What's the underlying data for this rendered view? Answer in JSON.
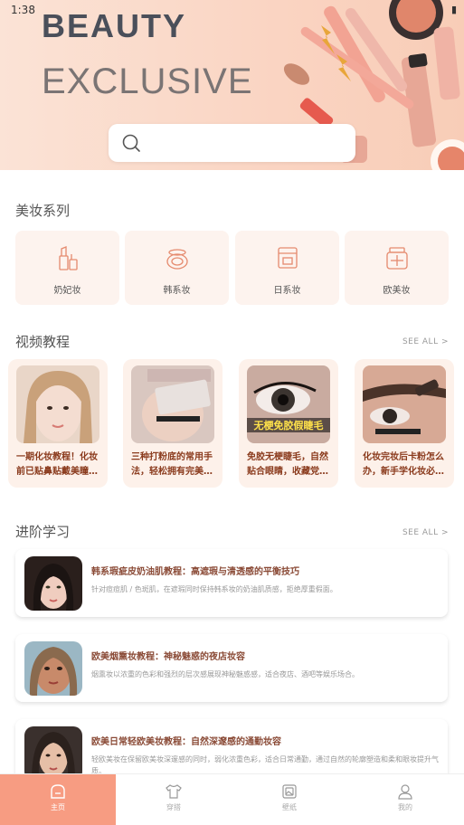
{
  "status": {
    "time": "1:38",
    "battery": "▮"
  },
  "hero": {
    "brand_line1": "BEAUTY",
    "brand_line2": "EXCLUSIVE",
    "search_placeholder": ""
  },
  "makeup_series": {
    "title": "美妆系列",
    "items": [
      {
        "label": "奶妃妆",
        "icon": "lipstick-icon"
      },
      {
        "label": "韩系妆",
        "icon": "compact-icon"
      },
      {
        "label": "日系妆",
        "icon": "palette-box-icon"
      },
      {
        "label": "欧美妆",
        "icon": "powder-jar-icon"
      }
    ]
  },
  "video_tutorials": {
    "title": "视频教程",
    "see_all": "SEE ALL >",
    "items": [
      {
        "title": "一期化妆教程！化妆前已贴鼻贴戴美瞳…"
      },
      {
        "title": "三种打粉底的常用手法，轻松拥有完美…"
      },
      {
        "title": "免胶无梗睫毛，自然贴合眼睛，收藏党…",
        "overlay": "无梗免胶假睫毛"
      },
      {
        "title": "化妆完妆后卡粉怎么办，新手学化妆必…"
      }
    ]
  },
  "advanced": {
    "title": "进阶学习",
    "see_all": "SEE ALL >",
    "items": [
      {
        "title": "韩系瑕疵皮奶油肌教程：高遮瑕与清透感的平衡技巧",
        "desc": "针对痘痘肌 / 色斑肌，在遮瑕同时保持韩系妆的奶油肌质感，拒绝厚重假面。"
      },
      {
        "title": "欧美烟熏妆教程：神秘魅惑的夜店妆容",
        "desc": "烟熏妆以浓重的色彩和强烈的层次感展现神秘魅惑感，适合夜店、酒吧等娱乐场合。"
      },
      {
        "title": "欧美日常轻欧美妆教程：自然深邃感的通勤妆容",
        "desc": "轻欧美妆在保留欧美妆深邃感的同时，弱化浓重色彩，适合日常通勤，通过自然的轮廓塑造和柔和眼妆提升气质。"
      }
    ]
  },
  "bottom_nav": [
    {
      "label": "主页",
      "icon": "home-icon",
      "active": true
    },
    {
      "label": "穿搭",
      "icon": "shirt-icon",
      "active": false
    },
    {
      "label": "壁纸",
      "icon": "wallpaper-icon",
      "active": false
    },
    {
      "label": "我的",
      "icon": "profile-icon",
      "active": false
    }
  ],
  "colors": {
    "accent": "#f79c82",
    "hero_bg": "#fad4c2",
    "card_bg": "#fdf3ee",
    "title_brown": "#8a3a1c"
  }
}
